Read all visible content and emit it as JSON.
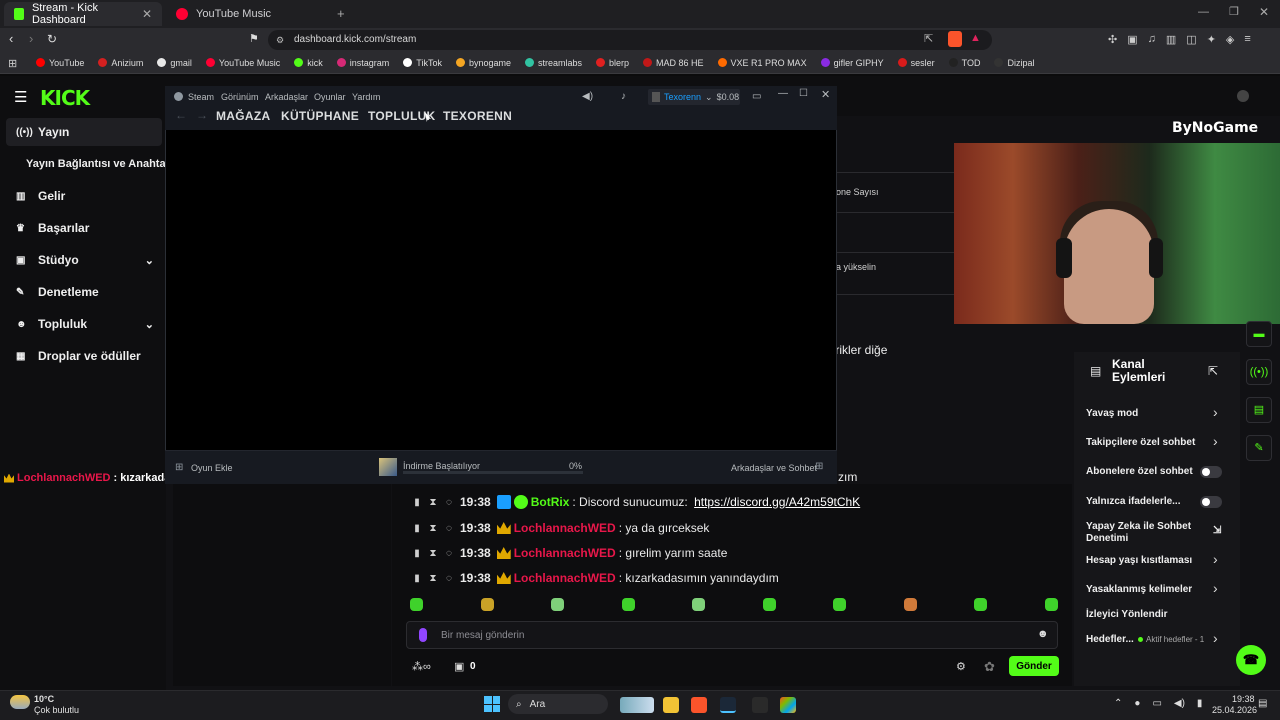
{
  "browser": {
    "tabs": [
      {
        "label": "Stream - Kick Dashboard",
        "active": true,
        "color": "#53fc18"
      },
      {
        "label": "YouTube Music",
        "active": false,
        "color": "#ff0033"
      }
    ],
    "url": "dashboard.kick.com/stream",
    "bookmarks": [
      {
        "label": "YouTube",
        "color": "#ff0000"
      },
      {
        "label": "Anizium",
        "color": "#d42020"
      },
      {
        "label": "gmail",
        "color": "#e8e8e8"
      },
      {
        "label": "YouTube Music",
        "color": "#ff0033"
      },
      {
        "label": "kick",
        "color": "#53fc18"
      },
      {
        "label": "instagram",
        "color": "#d62976"
      },
      {
        "label": "TikTok",
        "color": "#ffffff"
      },
      {
        "label": "bynogame",
        "color": "#f5a623"
      },
      {
        "label": "streamlabs",
        "color": "#31c3a2"
      },
      {
        "label": "blerp",
        "color": "#e02020"
      },
      {
        "label": "MAD 86 HE",
        "color": "#c01818"
      },
      {
        "label": "VXE R1 PRO MAX",
        "color": "#ff6a00"
      },
      {
        "label": "gifler GIPHY",
        "color": "#8a2be2"
      },
      {
        "label": "sesler",
        "color": "#d81b1b"
      },
      {
        "label": "TOD",
        "color": "#222222"
      },
      {
        "label": "Dizipal",
        "color": "#333333"
      }
    ]
  },
  "kick": {
    "logo": "KICK",
    "sidebar": [
      {
        "label": "Yayın",
        "icon": "broadcast-icon",
        "active": true
      },
      {
        "label": "Yayın Bağlantısı ve Anahtarı",
        "icon": "",
        "active": false
      },
      {
        "label": "Gelir",
        "icon": "chart-icon",
        "active": false
      },
      {
        "label": "Başarılar",
        "icon": "trophy-icon",
        "active": false
      },
      {
        "label": "Stüdyo",
        "icon": "studio-icon",
        "active": false,
        "expand": true
      },
      {
        "label": "Denetleme",
        "icon": "wrench-icon",
        "active": false
      },
      {
        "label": "Topluluk",
        "icon": "people-icon",
        "active": false,
        "expand": true
      },
      {
        "label": "Droplar ve ödüller",
        "icon": "gift-icon",
        "active": false
      }
    ],
    "partial_labels": {
      "subs": "one Sayısı",
      "rise": "a yükselin",
      "congrats": "ebrikler diğe",
      "partial_word": "zım"
    },
    "overlay_msg": {
      "user": "LochlannachWED",
      "text": ": kızarkadasımın yanındaydım"
    },
    "chat": {
      "messages": [
        {
          "time": "19:38",
          "user": "BotRix",
          "text": ": Discord sunucumuz: ",
          "link": "https://discord.gg/A42m59tChK",
          "type": "bot"
        },
        {
          "time": "19:38",
          "user": "LochlannachWED",
          "text": ": ya da gırceksek",
          "type": "user"
        },
        {
          "time": "19:38",
          "user": "LochlannachWED",
          "text": ": gırelim yarım saate",
          "type": "user"
        },
        {
          "time": "19:38",
          "user": "LochlannachWED",
          "text": ": kızarkadasımın yanındaydım",
          "type": "user"
        }
      ],
      "placeholder": "Bir mesaj gönderin",
      "send_label": "Gönder",
      "count": "0"
    },
    "channel_actions": {
      "title": "Kanal Eylemleri",
      "items": [
        {
          "label": "Yavaş mod",
          "kind": "arrow"
        },
        {
          "label": "Takipçilere özel sohbet",
          "kind": "arrow"
        },
        {
          "label": "Abonelere özel sohbet",
          "kind": "toggle"
        },
        {
          "label": "Yalnızca ifadelerle...",
          "kind": "toggle"
        },
        {
          "label": "Yapay Zeka ile Sohbet Denetimi",
          "kind": "external"
        },
        {
          "label": "Hesap yaşı kısıtlaması",
          "kind": "arrow"
        },
        {
          "label": "Yasaklanmış kelimeler",
          "kind": "arrow"
        },
        {
          "label": "İzleyici Yönlendir",
          "kind": "none"
        },
        {
          "label": "Hedefler...",
          "kind": "arrow",
          "sub": "Aktif hedefler - 1"
        }
      ]
    },
    "overlay_brand": "ByNoGame"
  },
  "steam": {
    "menu": [
      "Steam",
      "Görünüm",
      "Arkadaşlar",
      "Oyunlar",
      "Yardım"
    ],
    "nav": [
      "MAĞAZA",
      "KÜTÜPHANE",
      "TOPLULUK",
      "TEXORENN"
    ],
    "account": "Texorenn",
    "balance": "$0.08",
    "add_game": "Oyun Ekle",
    "download_status": "İndirme Başlatılıyor",
    "download_progress": 0,
    "download_percent": "0%",
    "friends": "Arkadaşlar ve Sohbet"
  },
  "taskbar": {
    "weather_temp": "10°C",
    "weather_desc": "Çok bulutlu",
    "search": "Ara",
    "time": "19:38",
    "date": "25.04.2026"
  }
}
